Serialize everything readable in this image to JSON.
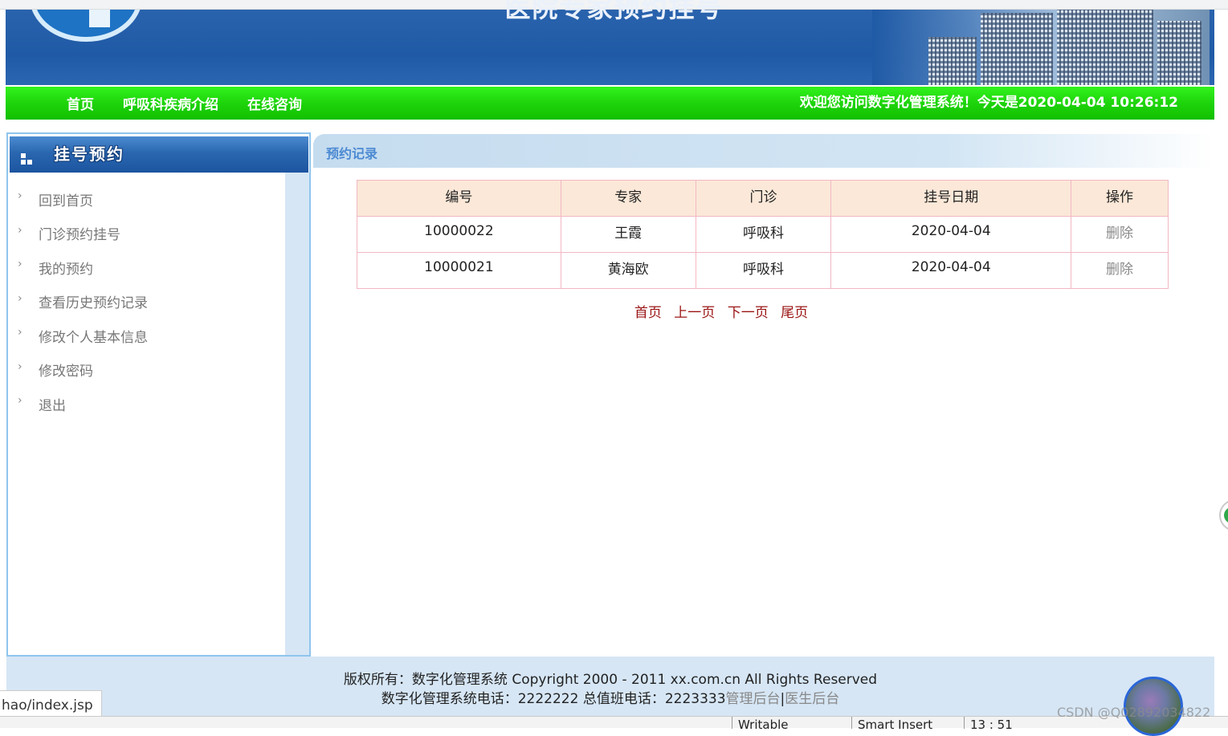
{
  "header": {
    "title": "医院专家预约挂号"
  },
  "nav": {
    "items": [
      {
        "label": "首页"
      },
      {
        "label": "呼吸科疾病介绍"
      },
      {
        "label": "在线咨询"
      }
    ],
    "welcome": "欢迎您访问数字化管理系统！今天是2020-04-04 10:26:12"
  },
  "sidebar": {
    "title": "挂号预约",
    "items": [
      {
        "label": "回到首页"
      },
      {
        "label": "门诊预约挂号"
      },
      {
        "label": "我的预约"
      },
      {
        "label": "查看历史预约记录"
      },
      {
        "label": "修改个人基本信息"
      },
      {
        "label": "修改密码"
      },
      {
        "label": "退出"
      }
    ]
  },
  "main": {
    "title": "预约记录",
    "table": {
      "headers": [
        "编号",
        "专家",
        "门诊",
        "挂号日期",
        "操作"
      ],
      "rows": [
        {
          "id": "10000022",
          "expert": "王霞",
          "clinic": "呼吸科",
          "date": "2020-04-04",
          "action": "删除"
        },
        {
          "id": "10000021",
          "expert": "黄海欧",
          "clinic": "呼吸科",
          "date": "2020-04-04",
          "action": "删除"
        }
      ]
    },
    "pager": {
      "first": "首页",
      "prev": "上一页",
      "next": "下一页",
      "last": "尾页"
    }
  },
  "footer": {
    "line1": "版权所有：数字化管理系统 Copyright 2000 - 2011 xx.com.cn All Rights Reserved",
    "line2_prefix": "数字化管理系统电话：2222222 总值班电话：2223333",
    "admin_link": "管理后台",
    "separator": "|",
    "doctor_link": "医生后台"
  },
  "status": {
    "link_preview": "hao/index.jsp",
    "cells": [
      "Writable",
      "Smart Insert",
      "13 : 51"
    ],
    "watermark": "CSDN @Q02892034822"
  },
  "colors": {
    "banner_blue": "#1f5aa6",
    "nav_green": "#1ed40b",
    "pager_red": "#9a1313",
    "table_border": "#f2b7c4",
    "table_header_bg": "#fbe8d8"
  },
  "icons": [
    "chevron-right-icon",
    "menu-squares-icon",
    "avatar",
    "floating-green-button"
  ]
}
